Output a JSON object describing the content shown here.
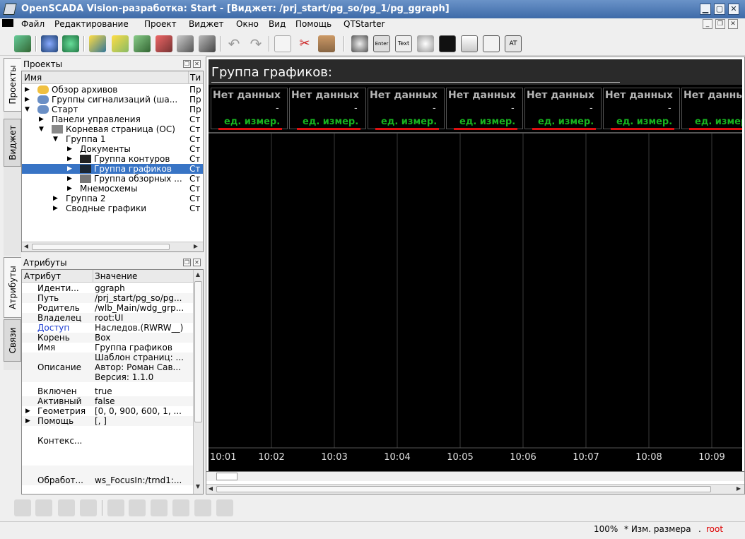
{
  "window": {
    "title": "OpenSCADA Vision-разработка: Start - [Виджет: /prj_start/pg_so/pg_1/pg_ggraph]"
  },
  "menu": [
    "Файл",
    "Редактирование",
    "Проект",
    "Виджет",
    "Окно",
    "Вид",
    "Помощь",
    "QTStarter"
  ],
  "left_tabs_top": [
    "Проекты",
    "Виджет"
  ],
  "left_tabs_bottom": [
    "Атрибуты",
    "Связи"
  ],
  "projects": {
    "title": "Проекты",
    "columns": [
      "Имя",
      "Ти"
    ],
    "rows": [
      {
        "label": "Обзор архивов",
        "type": "Пр"
      },
      {
        "label": "Группы сигнализаций (ша...",
        "type": "Пр"
      },
      {
        "label": "Старт",
        "type": "Пр"
      },
      {
        "label": "Панели управления",
        "type": "Ст"
      },
      {
        "label": "Корневая страница (ОС)",
        "type": "Ст"
      },
      {
        "label": "Группа 1",
        "type": "Ст"
      },
      {
        "label": "Документы",
        "type": "Ст"
      },
      {
        "label": "Группа контуров",
        "type": "Ст"
      },
      {
        "label": "Группа графиков",
        "type": "Ст"
      },
      {
        "label": "Группа обзорных ...",
        "type": "Ст"
      },
      {
        "label": "Мнемосхемы",
        "type": "Ст"
      },
      {
        "label": "Группа 2",
        "type": "Ст"
      },
      {
        "label": "Сводные графики",
        "type": "Ст"
      }
    ]
  },
  "attributes": {
    "title": "Атрибуты",
    "columns": [
      "Атрибут",
      "Значение"
    ],
    "rows": [
      {
        "name": "Иденти...",
        "value": "ggraph"
      },
      {
        "name": "Путь",
        "value": "/prj_start/pg_so/pg..."
      },
      {
        "name": "Родитель",
        "value": "/wlb_Main/wdg_grp..."
      },
      {
        "name": "Владелец",
        "value": "root:UI"
      },
      {
        "name": "Доступ",
        "value": "Наследов.(RWRW__)"
      },
      {
        "name": "Корень",
        "value": "Box"
      },
      {
        "name": "Имя",
        "value": "Группа графиков"
      },
      {
        "name": "Описание",
        "value": "Шаблон страниц: ...",
        "value2": "Автор: Роман Сав...",
        "value3": "Версия: 1.1.0"
      },
      {
        "name": "Включен",
        "value": "true"
      },
      {
        "name": "Активный",
        "value": "false"
      },
      {
        "name": "Геометрия",
        "value": "[0, 0, 900, 600, 1, ..."
      },
      {
        "name": "Помощь",
        "value": "[, ]"
      },
      {
        "name": "Контекс...",
        "value": ""
      },
      {
        "name": "Обработ...",
        "value": "ws_FocusIn:/trnd1:..."
      }
    ]
  },
  "widget": {
    "title": "Группа графиков:",
    "cells": [
      {
        "label": "Нет данных",
        "value": "-",
        "unit": "ед. измер."
      },
      {
        "label": "Нет данных",
        "value": "-",
        "unit": "ед. измер."
      },
      {
        "label": "Нет данных",
        "value": "-",
        "unit": "ед. измер."
      },
      {
        "label": "Нет данных",
        "value": "-",
        "unit": "ед. измер."
      },
      {
        "label": "Нет данных",
        "value": "-",
        "unit": "ед. измер."
      },
      {
        "label": "Нет данных",
        "value": "-",
        "unit": "ед. измер."
      },
      {
        "label": "Нет данных",
        "value": "-",
        "unit": "ед. измер."
      }
    ],
    "time_ticks": [
      "10:01",
      "10:02",
      "10:03",
      "10:04",
      "10:05",
      "10:06",
      "10:07",
      "10:08",
      "10:09"
    ],
    "colors": {
      "background": "#000000",
      "unit_text": "#17b31f",
      "unit_bar": "#e01010",
      "grid": "#3a3a3a"
    }
  },
  "status": {
    "zoom": "100%",
    "mode": "* Изм. размера",
    "user": "root",
    "user_color": "#dd0000"
  }
}
